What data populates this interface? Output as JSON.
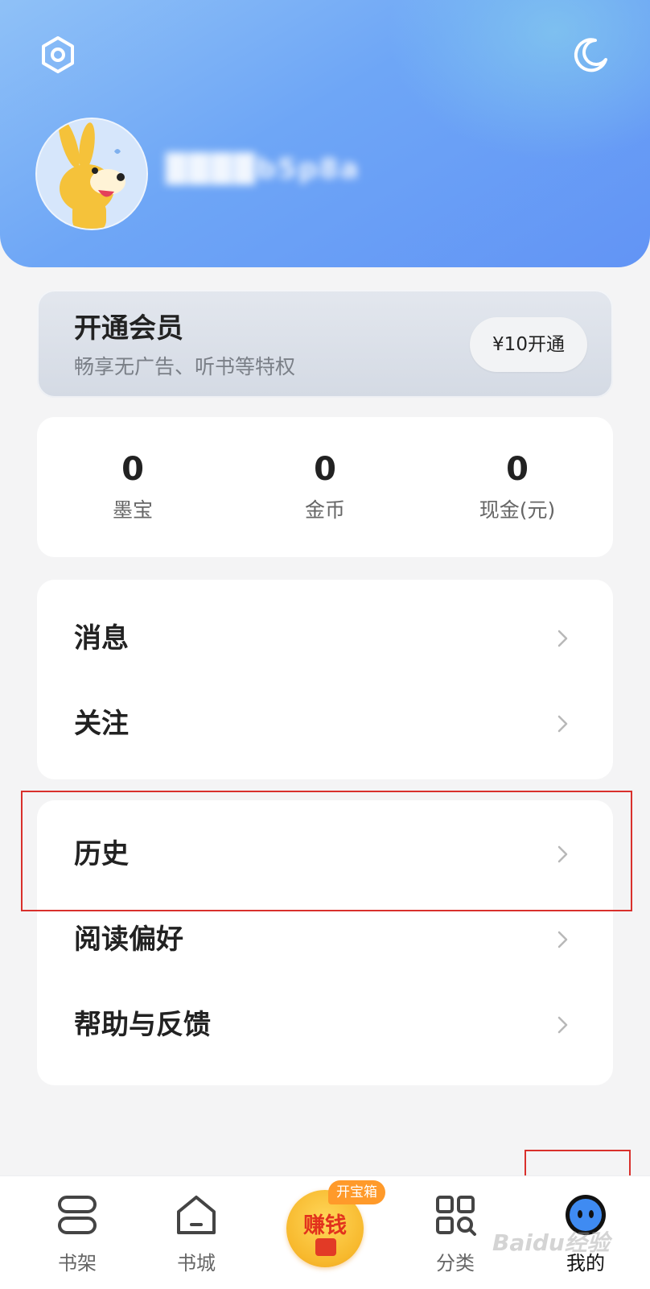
{
  "header": {
    "settings_icon": "settings-hex-icon",
    "night_mode_icon": "moon-icon",
    "username": "████b5p8a"
  },
  "vip": {
    "title": "开通会员",
    "subtitle": "畅享无广告、听书等特权",
    "button": "¥10开通"
  },
  "stats": [
    {
      "value": "0",
      "label": "墨宝"
    },
    {
      "value": "0",
      "label": "金币"
    },
    {
      "value": "0",
      "label": "现金(元)"
    }
  ],
  "menu": {
    "messages": "消息",
    "follow": "关注",
    "history": "历史",
    "reading_prefs": "阅读偏好",
    "help": "帮助与反馈"
  },
  "tabbar": {
    "bookshelf": "书架",
    "bookstore": "书城",
    "earn": "赚钱",
    "earn_badge": "开宝箱",
    "category": "分类",
    "mine": "我的"
  },
  "watermark": "Baidu经验"
}
